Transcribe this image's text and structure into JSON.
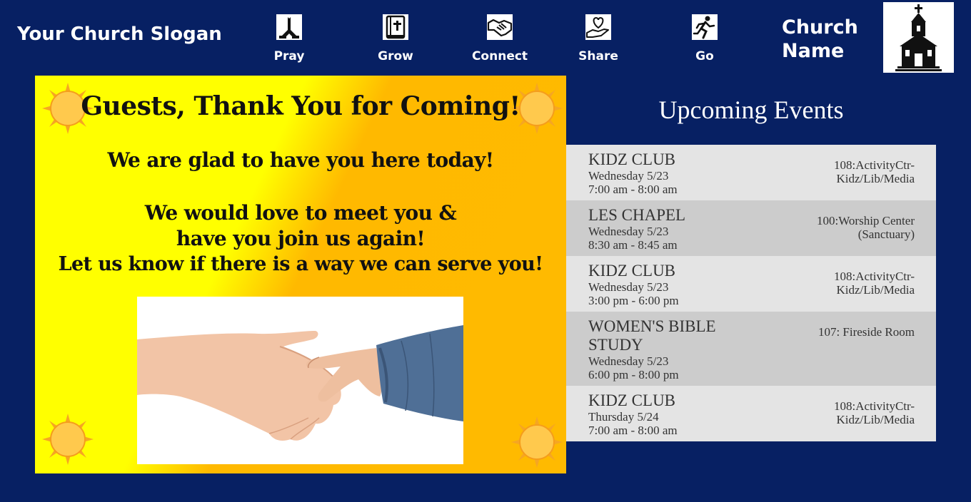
{
  "header": {
    "slogan": "Your Church Slogan",
    "nav": [
      {
        "label": "Pray",
        "icon": "praying-hands-icon"
      },
      {
        "label": "Grow",
        "icon": "bible-icon"
      },
      {
        "label": "Connect",
        "icon": "handshake-icon"
      },
      {
        "label": "Share",
        "icon": "heart-in-hand-icon"
      },
      {
        "label": "Go",
        "icon": "running-person-icon"
      }
    ],
    "church_name_line1": "Church",
    "church_name_line2": "Name",
    "logo_icon": "church-building-icon"
  },
  "slide": {
    "title": "Guests, Thank You for Coming!",
    "line1": "We are glad to have you here today!",
    "line2": "We would love to meet  you &",
    "line3": "have you join us again!",
    "line4": "Let us know if there is a way we can serve you!",
    "image_icon": "handshake-photo"
  },
  "events": {
    "title": "Upcoming Events",
    "items": [
      {
        "name": "KIDZ CLUB",
        "date": "Wednesday 5/23",
        "time": "7:00 am - 8:00 am",
        "room1": "108:ActivityCtr-",
        "room2": "Kidz/Lib/Media"
      },
      {
        "name": "LES CHAPEL",
        "date": "Wednesday 5/23",
        "time": "8:30 am - 8:45 am",
        "room1": "100:Worship Center",
        "room2": "(Sanctuary)"
      },
      {
        "name": "KIDZ CLUB",
        "date": "Wednesday 5/23",
        "time": "3:00 pm - 6:00 pm",
        "room1": "108:ActivityCtr-",
        "room2": "Kidz/Lib/Media"
      },
      {
        "name": "WOMEN'S BIBLE STUDY",
        "date": "Wednesday 5/23",
        "time": "6:00 pm - 8:00 pm",
        "room1": "107: Fireside Room",
        "room2": ""
      },
      {
        "name": "KIDZ CLUB",
        "date": "Thursday 5/24",
        "time": "7:00 am - 8:00 am",
        "room1": "108:ActivityCtr-",
        "room2": "Kidz/Lib/Media"
      }
    ]
  },
  "colors": {
    "background": "#072063",
    "slide_yellow": "#ffff00",
    "slide_orange": "#ffba00",
    "row_light": "#e4e4e4",
    "row_dark": "#cccccc"
  }
}
